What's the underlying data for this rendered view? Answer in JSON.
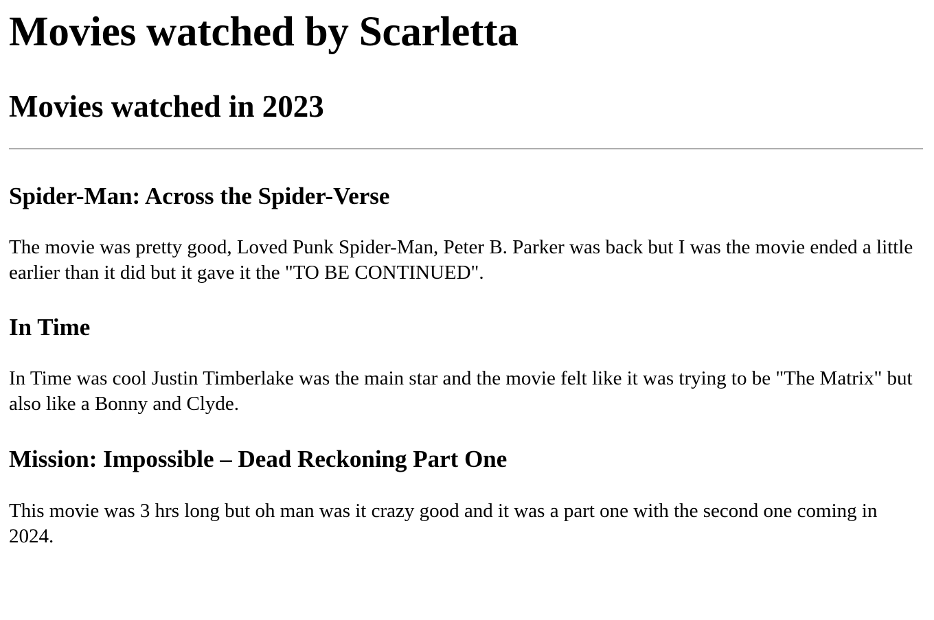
{
  "page": {
    "title": "Movies watched by Scarletta",
    "section_title": "Movies watched in 2023"
  },
  "movies": [
    {
      "title": "Spider-Man: Across the Spider-Verse",
      "review": "The movie was pretty good, Loved Punk Spider-Man, Peter B. Parker was back but I was the movie ended a little earlier than it did but it gave it the \"TO BE CONTINUED\"."
    },
    {
      "title": "In Time",
      "review": "In Time was cool Justin Timberlake was the main star and the movie felt like it was trying to be \"The Matrix\" but also like a Bonny and Clyde."
    },
    {
      "title": "Mission: Impossible – Dead Reckoning Part One",
      "review": "This movie was 3 hrs long but oh man was it crazy good and it was a part one with the second one coming in 2024."
    }
  ]
}
